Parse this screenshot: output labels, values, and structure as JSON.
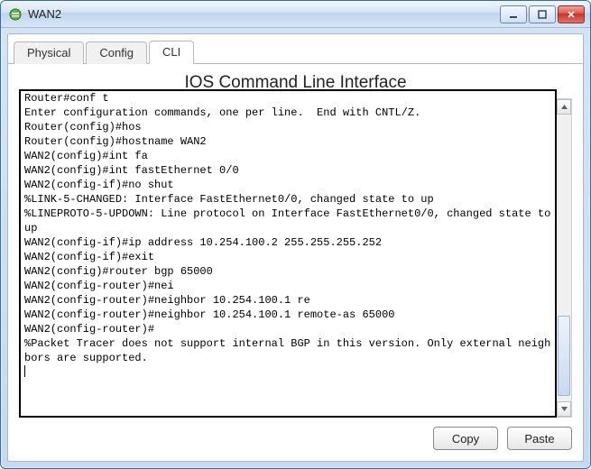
{
  "window": {
    "title": "WAN2"
  },
  "tabs": [
    {
      "label": "Physical",
      "active": false
    },
    {
      "label": "Config",
      "active": false
    },
    {
      "label": "CLI",
      "active": true
    }
  ],
  "panel": {
    "title": "IOS Command Line Interface",
    "copy_label": "Copy",
    "paste_label": "Paste"
  },
  "terminal_lines": [
    "Router#conf t",
    "Enter configuration commands, one per line.  End with CNTL/Z.",
    "Router(config)#hos",
    "Router(config)#hostname WAN2",
    "WAN2(config)#int fa",
    "WAN2(config)#int fastEthernet 0/0",
    "WAN2(config-if)#no shut",
    "",
    "%LINK-5-CHANGED: Interface FastEthernet0/0, changed state to up",
    "",
    "%LINEPROTO-5-UPDOWN: Line protocol on Interface FastEthernet0/0, changed state to up",
    "",
    "WAN2(config-if)#ip address 10.254.100.2 255.255.255.252",
    "WAN2(config-if)#exit",
    "WAN2(config)#router bgp 65000",
    "WAN2(config-router)#nei",
    "WAN2(config-router)#neighbor 10.254.100.1 re",
    "WAN2(config-router)#neighbor 10.254.100.1 remote-as 65000",
    "WAN2(config-router)#",
    "%Packet Tracer does not support internal BGP in this version. Only external neighbors are supported.",
    ""
  ]
}
